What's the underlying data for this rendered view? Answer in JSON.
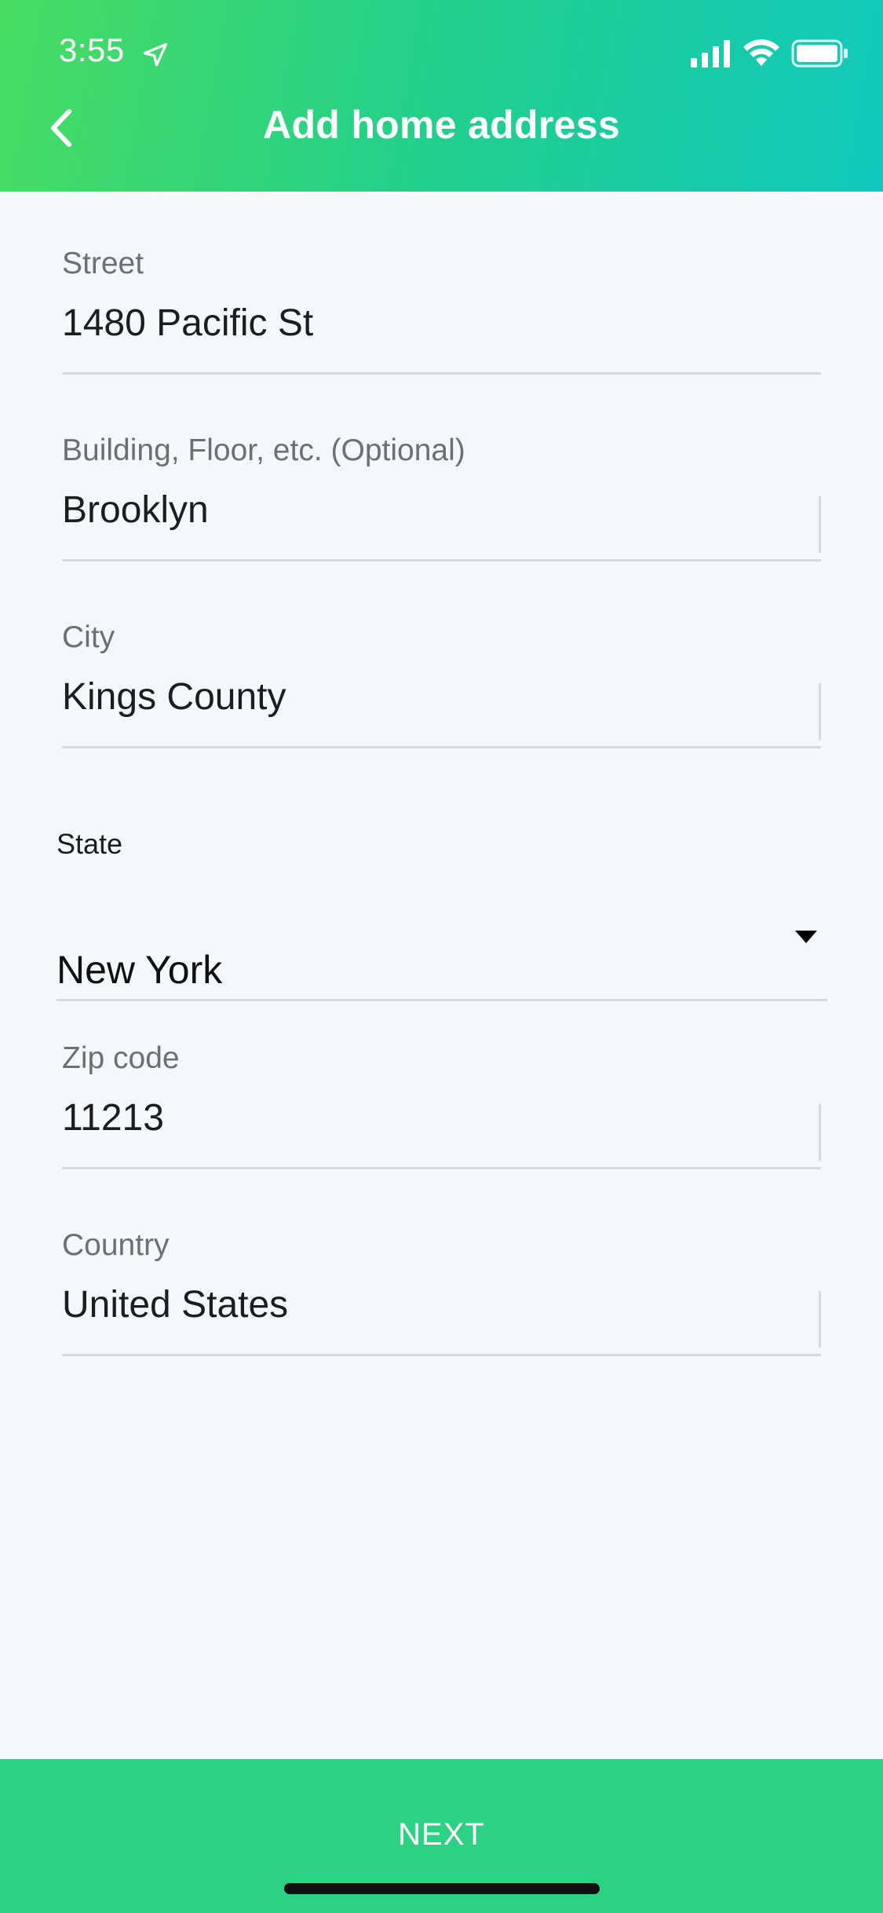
{
  "status_bar": {
    "time": "3:55"
  },
  "nav": {
    "title": "Add home address",
    "back_icon": "chevron-left-icon"
  },
  "form": {
    "street": {
      "label": "Street",
      "value": "1480 Pacific St"
    },
    "building": {
      "label": "Building, Floor, etc. (Optional)",
      "value": "Brooklyn"
    },
    "city": {
      "label": "City",
      "value": "Kings County"
    },
    "state": {
      "label": "State",
      "value": "New York",
      "icon": "caret-down-icon"
    },
    "zip": {
      "label": "Zip code",
      "value": "11213"
    },
    "country": {
      "label": "Country",
      "value": "United States"
    }
  },
  "footer": {
    "next_label": "NEXT"
  },
  "colors": {
    "header_gradient_start": "#48dc62",
    "header_gradient_end": "#10c9bd",
    "next_button": "#2dd184",
    "background": "#f4f8fb"
  }
}
